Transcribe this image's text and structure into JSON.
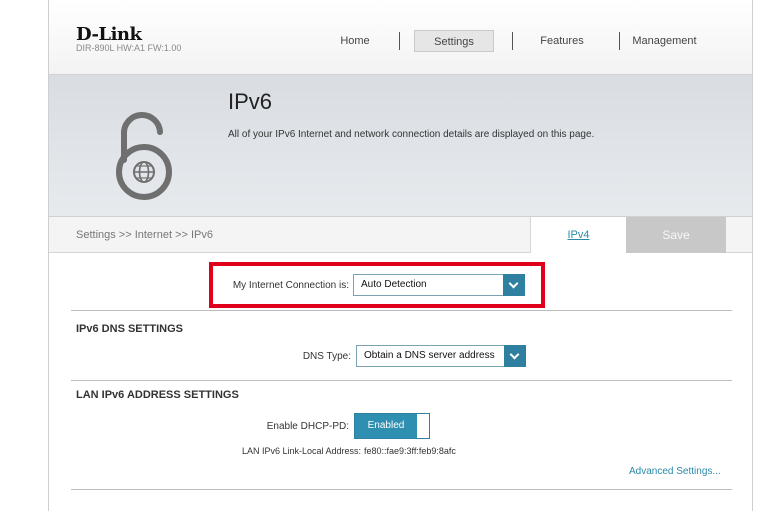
{
  "header": {
    "logo": "D-Link",
    "device_info": "DIR-890L   HW:A1   FW:1.00",
    "nav": [
      "Home",
      "Settings",
      "Features",
      "Management"
    ]
  },
  "banner": {
    "title": "IPv6",
    "description": "All of your IPv6 Internet and network connection details are displayed on this page."
  },
  "breadcrumb": "Settings >> Internet >> IPv6",
  "actions": {
    "ipv4_link": "IPv4",
    "save": "Save"
  },
  "connection": {
    "label": "My Internet Connection is:",
    "value": "Auto Detection"
  },
  "dns": {
    "section_title": "IPv6 DNS SETTINGS",
    "type_label": "DNS Type:",
    "type_value": "Obtain a DNS server address"
  },
  "lan": {
    "section_title": "LAN IPv6 ADDRESS SETTINGS",
    "dhcp_pd_label": "Enable DHCP-PD:",
    "dhcp_pd_value": "Enabled",
    "link_local_label": "LAN IPv6 Link-Local Address:",
    "link_local_value": "fe80::fae9:3ff:feb9:8afc"
  },
  "advanced_link": "Advanced Settings...",
  "colors": {
    "accent": "#2f7fa0",
    "highlight": "#e0001c",
    "link": "#2a8aa8"
  }
}
